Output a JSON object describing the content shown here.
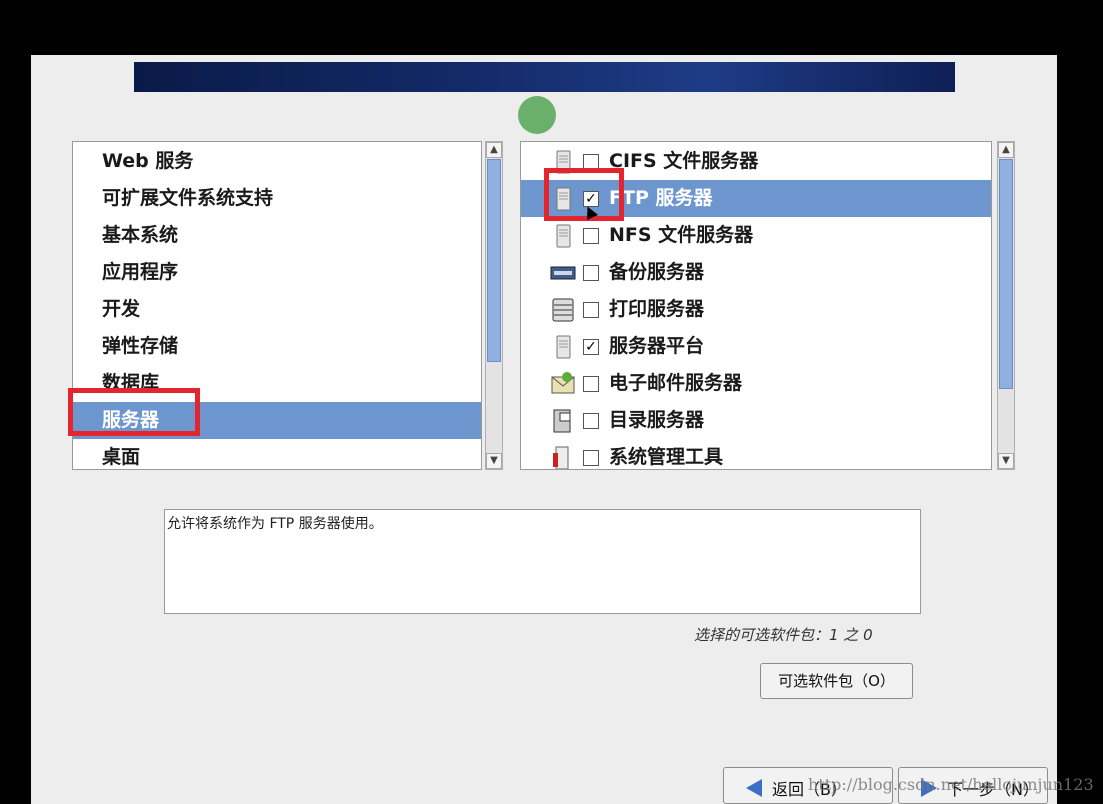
{
  "categories": {
    "items": [
      {
        "label": "Web 服务",
        "selected": false
      },
      {
        "label": "可扩展文件系统支持",
        "selected": false
      },
      {
        "label": "基本系统",
        "selected": false
      },
      {
        "label": "应用程序",
        "selected": false
      },
      {
        "label": "开发",
        "selected": false
      },
      {
        "label": "弹性存储",
        "selected": false
      },
      {
        "label": "数据库",
        "selected": false
      },
      {
        "label": "服务器",
        "selected": true
      },
      {
        "label": "桌面",
        "selected": false
      }
    ]
  },
  "packages": {
    "items": [
      {
        "label": "CIFS 文件服务器",
        "checked": false,
        "icon": "server-tower-icon",
        "selected": false
      },
      {
        "label": "FTP 服务器",
        "checked": true,
        "icon": "server-tower-icon",
        "selected": true
      },
      {
        "label": "NFS 文件服务器",
        "checked": false,
        "icon": "server-tower-icon",
        "selected": false
      },
      {
        "label": "备份服务器",
        "checked": false,
        "icon": "tape-drive-icon",
        "selected": false
      },
      {
        "label": "打印服务器",
        "checked": false,
        "icon": "printer-icon",
        "selected": false
      },
      {
        "label": "服务器平台",
        "checked": true,
        "icon": "server-tower-icon",
        "selected": false
      },
      {
        "label": "电子邮件服务器",
        "checked": false,
        "icon": "mail-server-icon",
        "selected": false
      },
      {
        "label": "目录服务器",
        "checked": false,
        "icon": "directory-server-icon",
        "selected": false
      },
      {
        "label": "系统管理工具",
        "checked": false,
        "icon": "admin-tools-icon",
        "selected": false
      }
    ]
  },
  "description": "允许将系统作为 FTP 服务器使用。",
  "selection_count": "选择的可选软件包：1 之 0",
  "optional_packages_button": "可选软件包（O）",
  "back_button": "返回（B）",
  "next_button": "下一步（N）",
  "watermark": "http://blog.csdn.net/hellojunjun123",
  "colors": {
    "selection": "#6d96cf",
    "highlight_box": "#e3262d",
    "banner": "#132a68"
  }
}
